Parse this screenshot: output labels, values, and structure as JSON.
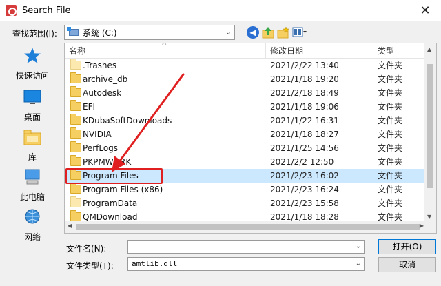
{
  "window": {
    "title": "Search File",
    "close_glyph": "✕"
  },
  "toolbar": {
    "lookin_label": "查找范围(I):",
    "lookin_value": "系统 (C:)",
    "icons": [
      "back-icon",
      "up-folder-icon",
      "new-folder-icon",
      "view-menu-icon"
    ]
  },
  "places": [
    {
      "label": "快速访问",
      "icon": "star-icon"
    },
    {
      "label": "桌面",
      "icon": "desktop-icon"
    },
    {
      "label": "库",
      "icon": "library-icon"
    },
    {
      "label": "此电脑",
      "icon": "computer-icon"
    },
    {
      "label": "网络",
      "icon": "network-icon"
    }
  ],
  "list": {
    "columns": {
      "name": "名称",
      "date": "修改日期",
      "type": "类型"
    },
    "rows": [
      {
        "name": ".Trashes",
        "date": "2021/2/22 13:40",
        "type": "文件夹"
      },
      {
        "name": "archive_db",
        "date": "2021/1/18 19:20",
        "type": "文件夹"
      },
      {
        "name": "Autodesk",
        "date": "2021/2/18 18:49",
        "type": "文件夹"
      },
      {
        "name": "EFI",
        "date": "2021/1/18 19:06",
        "type": "文件夹"
      },
      {
        "name": "KDubaSoftDownloads",
        "date": "2021/1/22 16:31",
        "type": "文件夹"
      },
      {
        "name": "NVIDIA",
        "date": "2021/1/18 18:27",
        "type": "文件夹"
      },
      {
        "name": "PerfLogs",
        "date": "2021/1/25 14:56",
        "type": "文件夹"
      },
      {
        "name": "PKPMWORK",
        "date": "2021/2/2 12:50",
        "type": "文件夹"
      },
      {
        "name": "Program Files",
        "date": "2021/2/23 16:02",
        "type": "文件夹",
        "selected": true
      },
      {
        "name": "Program Files (x86)",
        "date": "2021/2/23 16:24",
        "type": "文件夹"
      },
      {
        "name": "ProgramData",
        "date": "2021/2/23 15:58",
        "type": "文件夹"
      },
      {
        "name": "QMDownload",
        "date": "2021/1/18 18:28",
        "type": "文件夹"
      }
    ]
  },
  "form": {
    "filename_label": "文件名(N):",
    "filename_value": "",
    "filetype_label": "文件类型(T):",
    "filetype_value": "amtlib.dll",
    "open_button": "打开(O)",
    "cancel_button": "取消"
  },
  "colors": {
    "selection": "#cce8ff",
    "annotation": "#e02020",
    "folder": "#f6cf62"
  }
}
